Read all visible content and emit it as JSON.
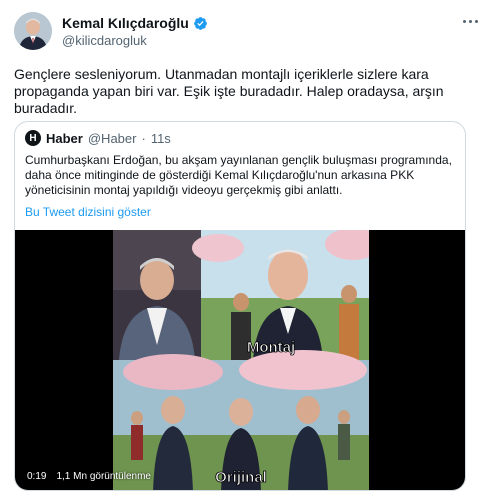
{
  "author": {
    "name": "Kemal Kılıçdaroğlu",
    "handle": "@kilicdarogluk",
    "verified_icon": "verified-badge-icon"
  },
  "tweet": {
    "text": "Gençlere sesleniyorum. Utanmadan montajlı içeriklerle sizlere kara propaganda yapan biri var. Eşik işte buradadır. Halep oradaysa, arşın buradadır."
  },
  "quoted": {
    "avatar_letter": "H",
    "name": "Haber",
    "handle": "@Haber",
    "separator": "·",
    "time": "11s",
    "text": "Cumhurbaşkanı Erdoğan, bu akşam yayınlanan gençlik buluşması programında, daha önce mitinginde de gösterdiği Kemal Kılıçdaroğlu'nun arkasına PKK yöneticisinin montaj yapıldığı videoyu gerçekmiş gibi anlattı.",
    "thread_link": "Bu Tweet dizisini göster"
  },
  "video": {
    "duration": "0:19",
    "views": "1,1 Mn görüntülenme",
    "caption_top": "Montaj",
    "caption_bottom": "Orijinal"
  },
  "colors": {
    "link": "#1d9bf0",
    "verified": "#1d9bf0",
    "secondary_text": "#536471",
    "border": "#cfd9de"
  }
}
